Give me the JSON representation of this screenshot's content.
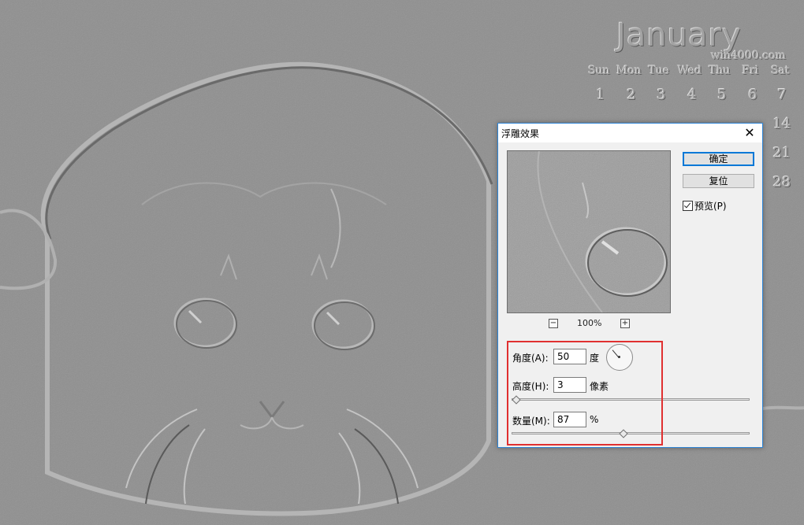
{
  "calendar": {
    "month": "January",
    "site": "win4000.com",
    "weekdays": [
      "Sun",
      "Mon",
      "Tue",
      "Wed",
      "Thu",
      "Fri",
      "Sat"
    ],
    "row1": [
      "1",
      "2",
      "3",
      "4",
      "5",
      "6",
      "7"
    ],
    "row2_visible": [
      "14"
    ],
    "row3_visible": [
      "21"
    ],
    "row4_visible": [
      "28"
    ]
  },
  "dialog": {
    "title": "浮雕效果",
    "close_glyph": "✕",
    "ok_label": "确定",
    "reset_label": "复位",
    "preview_label": "预览(P)",
    "preview_checked": true,
    "zoom": {
      "minus": "−",
      "plus": "+",
      "level": "100%"
    },
    "angle": {
      "label": "角度(A):",
      "value": "50",
      "unit": "度"
    },
    "height": {
      "label": "高度(H):",
      "value": "3",
      "unit": "像素",
      "slider_fraction": 0.02
    },
    "amount": {
      "label": "数量(M):",
      "value": "87",
      "unit": "%",
      "slider_fraction": 0.47
    }
  },
  "colors": {
    "accent": "#0078d7",
    "dialog_border": "#2d84d6",
    "highlight": "#e03030",
    "background": "#8e8e8e"
  }
}
